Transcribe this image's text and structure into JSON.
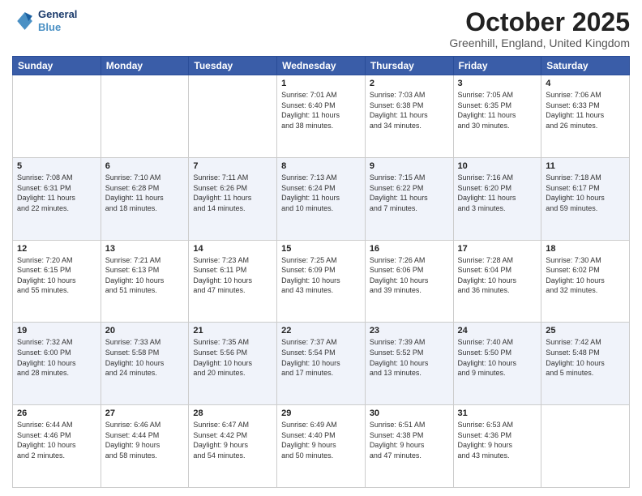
{
  "header": {
    "logo_line1": "General",
    "logo_line2": "Blue",
    "month_title": "October 2025",
    "location": "Greenhill, England, United Kingdom"
  },
  "days_of_week": [
    "Sunday",
    "Monday",
    "Tuesday",
    "Wednesday",
    "Thursday",
    "Friday",
    "Saturday"
  ],
  "weeks": [
    [
      {
        "day": "",
        "info": ""
      },
      {
        "day": "",
        "info": ""
      },
      {
        "day": "",
        "info": ""
      },
      {
        "day": "1",
        "info": "Sunrise: 7:01 AM\nSunset: 6:40 PM\nDaylight: 11 hours\nand 38 minutes."
      },
      {
        "day": "2",
        "info": "Sunrise: 7:03 AM\nSunset: 6:38 PM\nDaylight: 11 hours\nand 34 minutes."
      },
      {
        "day": "3",
        "info": "Sunrise: 7:05 AM\nSunset: 6:35 PM\nDaylight: 11 hours\nand 30 minutes."
      },
      {
        "day": "4",
        "info": "Sunrise: 7:06 AM\nSunset: 6:33 PM\nDaylight: 11 hours\nand 26 minutes."
      }
    ],
    [
      {
        "day": "5",
        "info": "Sunrise: 7:08 AM\nSunset: 6:31 PM\nDaylight: 11 hours\nand 22 minutes."
      },
      {
        "day": "6",
        "info": "Sunrise: 7:10 AM\nSunset: 6:28 PM\nDaylight: 11 hours\nand 18 minutes."
      },
      {
        "day": "7",
        "info": "Sunrise: 7:11 AM\nSunset: 6:26 PM\nDaylight: 11 hours\nand 14 minutes."
      },
      {
        "day": "8",
        "info": "Sunrise: 7:13 AM\nSunset: 6:24 PM\nDaylight: 11 hours\nand 10 minutes."
      },
      {
        "day": "9",
        "info": "Sunrise: 7:15 AM\nSunset: 6:22 PM\nDaylight: 11 hours\nand 7 minutes."
      },
      {
        "day": "10",
        "info": "Sunrise: 7:16 AM\nSunset: 6:20 PM\nDaylight: 11 hours\nand 3 minutes."
      },
      {
        "day": "11",
        "info": "Sunrise: 7:18 AM\nSunset: 6:17 PM\nDaylight: 10 hours\nand 59 minutes."
      }
    ],
    [
      {
        "day": "12",
        "info": "Sunrise: 7:20 AM\nSunset: 6:15 PM\nDaylight: 10 hours\nand 55 minutes."
      },
      {
        "day": "13",
        "info": "Sunrise: 7:21 AM\nSunset: 6:13 PM\nDaylight: 10 hours\nand 51 minutes."
      },
      {
        "day": "14",
        "info": "Sunrise: 7:23 AM\nSunset: 6:11 PM\nDaylight: 10 hours\nand 47 minutes."
      },
      {
        "day": "15",
        "info": "Sunrise: 7:25 AM\nSunset: 6:09 PM\nDaylight: 10 hours\nand 43 minutes."
      },
      {
        "day": "16",
        "info": "Sunrise: 7:26 AM\nSunset: 6:06 PM\nDaylight: 10 hours\nand 39 minutes."
      },
      {
        "day": "17",
        "info": "Sunrise: 7:28 AM\nSunset: 6:04 PM\nDaylight: 10 hours\nand 36 minutes."
      },
      {
        "day": "18",
        "info": "Sunrise: 7:30 AM\nSunset: 6:02 PM\nDaylight: 10 hours\nand 32 minutes."
      }
    ],
    [
      {
        "day": "19",
        "info": "Sunrise: 7:32 AM\nSunset: 6:00 PM\nDaylight: 10 hours\nand 28 minutes."
      },
      {
        "day": "20",
        "info": "Sunrise: 7:33 AM\nSunset: 5:58 PM\nDaylight: 10 hours\nand 24 minutes."
      },
      {
        "day": "21",
        "info": "Sunrise: 7:35 AM\nSunset: 5:56 PM\nDaylight: 10 hours\nand 20 minutes."
      },
      {
        "day": "22",
        "info": "Sunrise: 7:37 AM\nSunset: 5:54 PM\nDaylight: 10 hours\nand 17 minutes."
      },
      {
        "day": "23",
        "info": "Sunrise: 7:39 AM\nSunset: 5:52 PM\nDaylight: 10 hours\nand 13 minutes."
      },
      {
        "day": "24",
        "info": "Sunrise: 7:40 AM\nSunset: 5:50 PM\nDaylight: 10 hours\nand 9 minutes."
      },
      {
        "day": "25",
        "info": "Sunrise: 7:42 AM\nSunset: 5:48 PM\nDaylight: 10 hours\nand 5 minutes."
      }
    ],
    [
      {
        "day": "26",
        "info": "Sunrise: 6:44 AM\nSunset: 4:46 PM\nDaylight: 10 hours\nand 2 minutes."
      },
      {
        "day": "27",
        "info": "Sunrise: 6:46 AM\nSunset: 4:44 PM\nDaylight: 9 hours\nand 58 minutes."
      },
      {
        "day": "28",
        "info": "Sunrise: 6:47 AM\nSunset: 4:42 PM\nDaylight: 9 hours\nand 54 minutes."
      },
      {
        "day": "29",
        "info": "Sunrise: 6:49 AM\nSunset: 4:40 PM\nDaylight: 9 hours\nand 50 minutes."
      },
      {
        "day": "30",
        "info": "Sunrise: 6:51 AM\nSunset: 4:38 PM\nDaylight: 9 hours\nand 47 minutes."
      },
      {
        "day": "31",
        "info": "Sunrise: 6:53 AM\nSunset: 4:36 PM\nDaylight: 9 hours\nand 43 minutes."
      },
      {
        "day": "",
        "info": ""
      }
    ]
  ]
}
